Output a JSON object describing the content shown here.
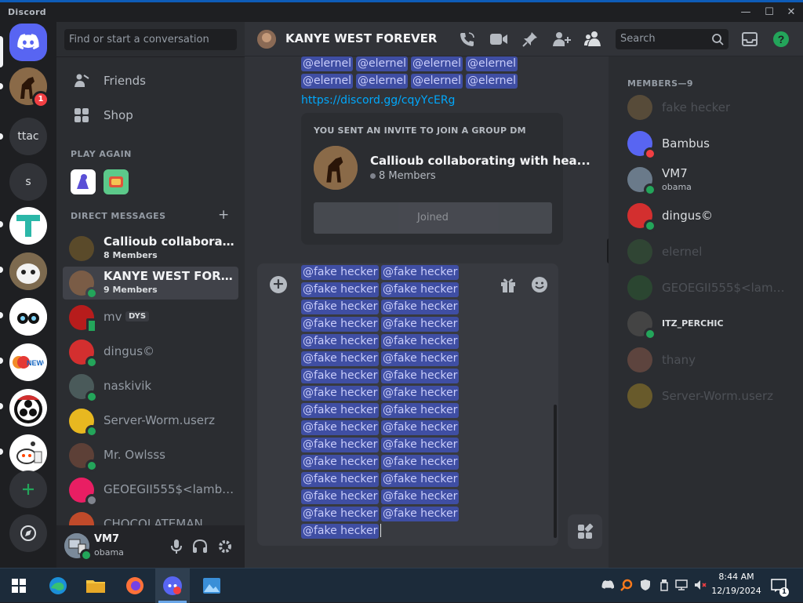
{
  "window": {
    "app_title": "Discord",
    "minimize": "—",
    "maximize": "☐",
    "close": "✕"
  },
  "servers": [
    {
      "name": "ttac"
    },
    {
      "name": "s"
    }
  ],
  "server_badge": "1",
  "sidebar": {
    "search_placeholder": "Find or start a conversation",
    "friends_label": "Friends",
    "shop_label": "Shop",
    "play_again_header": "PLAY AGAIN",
    "dm_header": "DIRECT MESSAGES",
    "add_dm": "+"
  },
  "dms": [
    {
      "name": "Callioub collaborating...",
      "sub": "8 Members",
      "status": "",
      "color": "#5a4a2a"
    },
    {
      "name": "KANYE WEST FOREV...",
      "sub": "9 Members",
      "status": "on",
      "color": "#7a5c46",
      "active": true
    },
    {
      "name": "mv",
      "tag": "DYS",
      "sub": "",
      "status": "mobile",
      "color": "#b71c1c"
    },
    {
      "name": "dingus©",
      "sub": "",
      "status": "on",
      "color": "#d32f2f"
    },
    {
      "name": "naskivik",
      "sub": "",
      "status": "on",
      "color": "#4a5a5a"
    },
    {
      "name": "Server-Worm.userz",
      "sub": "",
      "status": "on",
      "color": "#e8b820"
    },
    {
      "name": "Mr. Owlsss",
      "sub": "",
      "status": "on",
      "color": "#5d4037"
    },
    {
      "name": "GEOEGII555$<lambd...",
      "sub": "",
      "status": "idle",
      "color": "#e91e63"
    },
    {
      "name": "CHOCOLATEMAN",
      "sub": "",
      "status": "",
      "color": "#c04a2a"
    }
  ],
  "user": {
    "name": "VM7",
    "status": "obama"
  },
  "header": {
    "channel_name": "KANYE WEST FOREVER",
    "search_placeholder": "Search"
  },
  "chat": {
    "mention_elernel": "@elernel",
    "invite_link": "https://discord.gg/cqyYcERg",
    "invite_header": "YOU SENT AN INVITE TO JOIN A GROUP DM",
    "invite_name": "Callioub collaborating with hea...",
    "invite_members": "8 Members",
    "invite_button": "Joined",
    "composer_add": "+",
    "mention_fake": "@fake hecker"
  },
  "members": {
    "header": "MEMBERS—9",
    "list": [
      {
        "name": "fake hecker",
        "status": "",
        "dim": true,
        "color": "#b48a4a"
      },
      {
        "name": "Bambus",
        "status": "dnd",
        "dim": false,
        "color": "#5865f2"
      },
      {
        "name": "VM7",
        "sub": "obama",
        "status": "on",
        "dim": false,
        "color": "#6a7a8a"
      },
      {
        "name": "dingus©",
        "status": "on",
        "dim": false,
        "color": "#d32f2f"
      },
      {
        "name": "elernel",
        "status": "",
        "dim": true,
        "color": "#3d7a3d"
      },
      {
        "name": "GEOEGII555$<lambd...",
        "status": "",
        "dim": true,
        "color": "#2e7d32"
      },
      {
        "name": "ITZ_PERCHIC",
        "status": "on",
        "dim": false,
        "color": "#444"
      },
      {
        "name": "thany",
        "status": "",
        "dim": true,
        "color": "#c7775a"
      },
      {
        "name": "Server-Worm.userz",
        "status": "",
        "dim": true,
        "color": "#e8b820"
      }
    ]
  },
  "taskbar": {
    "time": "8:44 AM",
    "date": "12/19/2024",
    "notif_count": "1"
  },
  "colors": {
    "blurple": "#5865f2",
    "online": "#23a55a",
    "dnd": "#f23f43",
    "idle": "#80848e",
    "mention_bg": "#414675"
  }
}
